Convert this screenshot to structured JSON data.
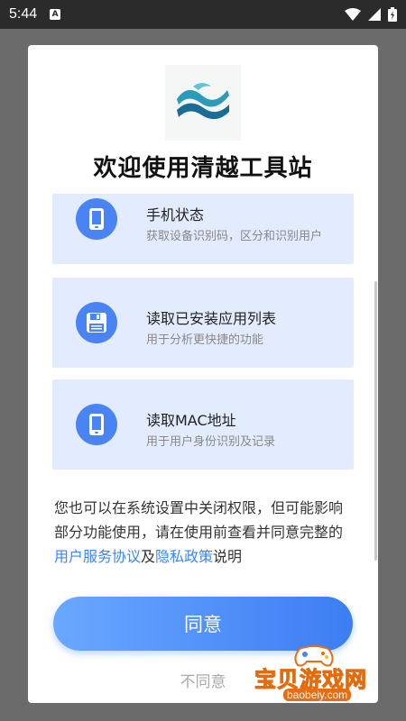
{
  "status_bar": {
    "time": "5:44",
    "notif_letter": "A"
  },
  "dialog": {
    "title": "欢迎使用清越工具站",
    "permissions": [
      {
        "title": "手机状态",
        "desc": "获取设备识别码，区分和识别用户",
        "icon": "phone-icon"
      },
      {
        "title": "读取已安装应用列表",
        "desc": "用于分析更快捷的功能",
        "icon": "floppy-disk-icon"
      },
      {
        "title": "读取MAC地址",
        "desc": "用于用户身份识别及记录",
        "icon": "phone-icon"
      }
    ],
    "notice": {
      "text_before": "您也可以在系统设置中关闭权限，但可能影响部分功能使用，请在使用前查看并同意完整的",
      "link_service": "用户服务协议",
      "and": "及",
      "link_privacy": "隐私政策",
      "text_after": "说明"
    },
    "agree_label": "同意",
    "disagree_label": "不同意"
  },
  "watermark": {
    "text": "宝贝游戏网",
    "url": "baobeiy.com"
  },
  "colors": {
    "accent": "#4a84f4",
    "card_bg": "#e3ecff",
    "link": "#3a86f5"
  }
}
